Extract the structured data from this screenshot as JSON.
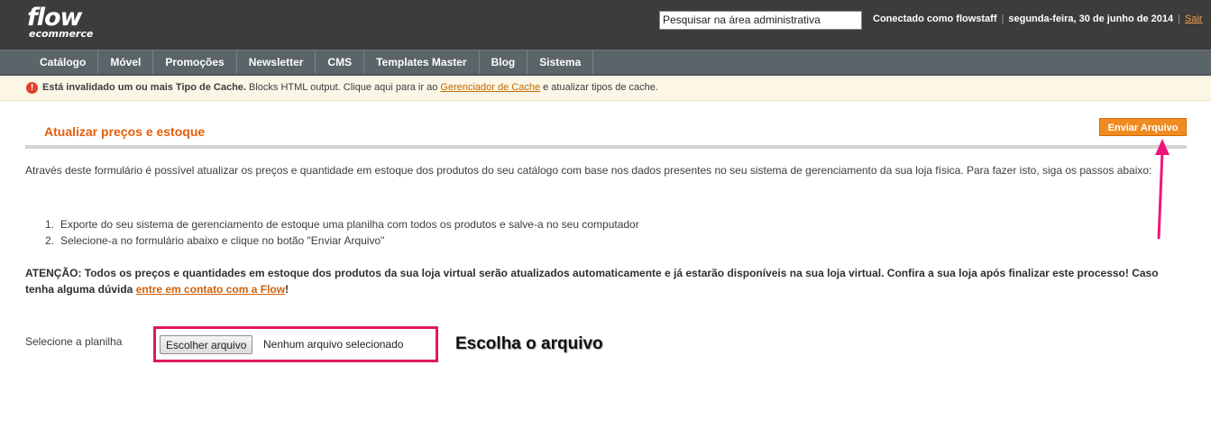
{
  "header": {
    "logo_main": "flow",
    "logo_sub": "ecommerce",
    "search_value": "Pesquisar na área administrativa",
    "user": "Conectado como flowstaff",
    "date": "segunda-feira, 30 de junho de 2014",
    "logout": "Sair"
  },
  "nav": {
    "items": [
      "Catálogo",
      "Móvel",
      "Promoções",
      "Newsletter",
      "CMS",
      "Templates Master",
      "Blog",
      "Sistema"
    ]
  },
  "message": {
    "icon": "!",
    "bold": "Está invalidado um ou mais Tipo de Cache.",
    "text1": " Blocks HTML output. Clique aqui para ir ao ",
    "link": "Gerenciador de Cache",
    "text2": " e atualizar tipos de cache."
  },
  "page": {
    "title": "Atualizar preços e estoque",
    "send_button": "Enviar Arquivo",
    "intro": "Através deste formulário é possível atualizar os preços e quantidade em estoque dos produtos do seu catálogo com base nos dados presentes no seu sistema de gerenciamento da sua loja física. Para fazer isto, siga os passos abaixo:",
    "steps": [
      {
        "num": "1.",
        "text": "Exporte do seu sistema de gerenciamento de estoque uma planilha com todos os produtos e salve-a no seu computador"
      },
      {
        "num": "2.",
        "text": "Selecione-a no formulário abaixo e clique no botão \"Enviar Arquivo\""
      }
    ],
    "warning_text": "ATENÇÃO: Todos os preços e quantidades em estoque dos produtos da sua loja virtual serão atualizados automaticamente e já estarão disponíveis na sua loja virtual. Confira a sua loja após finalizar este processo! Caso tenha alguma dúvida ",
    "warning_link": "entre em contato com a Flow",
    "warning_end": "!",
    "field_label": "Selecione a planilha",
    "file_button": "Escolher arquivo",
    "file_status": "Nenhum arquivo selecionado",
    "annotation": "Escolha o arquivo"
  },
  "colors": {
    "header_bg": "#3c3c3c",
    "nav_bg": "#5b6468",
    "accent_orange": "#f18b1f",
    "title_orange": "#e25f0a",
    "highlight_pink": "#e0185e"
  }
}
